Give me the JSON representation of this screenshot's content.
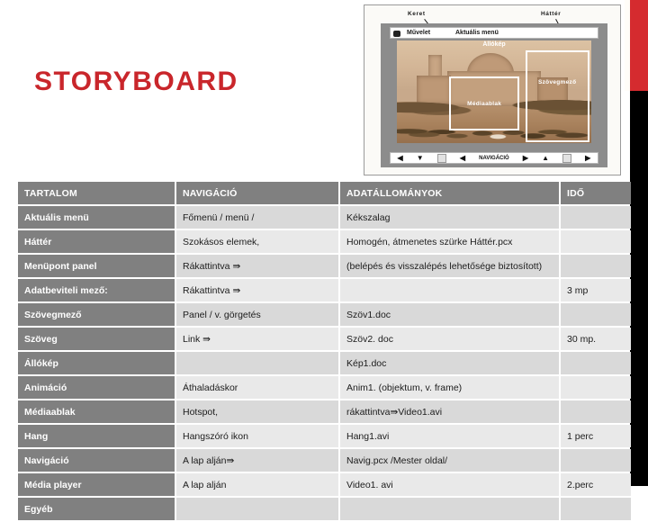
{
  "page_title": "STORYBOARD",
  "accent": {
    "red": "#d52b2f",
    "black": "#000000",
    "gray": "#808080"
  },
  "mockup": {
    "annotations": {
      "frame_label": "Keret",
      "background_label": "Háttér"
    },
    "menubar": {
      "action_label": "Művelet",
      "current_menu_label": "Aktuális menü",
      "icon": "speaker-icon"
    },
    "overlays": {
      "stillimage_label": "Állókép",
      "mediawindow_label": "Médiaablak",
      "textfield_label": "Szövegmező"
    },
    "navbar": {
      "label": "NAVIGÁCIÓ",
      "buttons": [
        "nav-left-icon",
        "nav-down-icon",
        "nav-box-icon",
        "nav-back-icon",
        "nav-forward-icon",
        "nav-up-icon",
        "nav-box2-icon",
        "nav-end-icon"
      ],
      "glyphs": [
        "◀",
        "▼",
        "▣",
        "◀",
        "▶",
        "▲",
        "▣",
        "▶|"
      ]
    }
  },
  "table": {
    "headers": [
      "TARTALOM",
      "NAVIGÁCIÓ",
      "ADATÁLLOMÁNYOK",
      "IDŐ"
    ],
    "rows": [
      {
        "tartalom": "Aktuális menü",
        "navigacio": "Főmenü / menü /",
        "adatallomanyok": "Kékszalag",
        "ido": ""
      },
      {
        "tartalom": "Háttér",
        "navigacio": "Szokásos elemek,",
        "adatallomanyok": "Homogén, átmenetes szürke Háttér.pcx",
        "ido": ""
      },
      {
        "tartalom": "Menüpont panel",
        "navigacio": "Rákattintva ⇛",
        "adatallomanyok": "(belépés és visszalépés lehetősége biztosított)",
        "ido": ""
      },
      {
        "tartalom": "Adatbeviteli mező:",
        "navigacio": "Rákattintva ⇛",
        "adatallomanyok": "",
        "ido": "3 mp"
      },
      {
        "tartalom": "Szövegmező",
        "navigacio": "Panel / v. görgetés",
        "adatallomanyok": "Szöv1.doc",
        "ido": ""
      },
      {
        "tartalom": "Szöveg",
        "navigacio": "Link ⇛",
        "adatallomanyok": "Szöv2. doc",
        "ido": "30 mp."
      },
      {
        "tartalom": "Állókép",
        "navigacio": "",
        "adatallomanyok": "Kép1.doc",
        "ido": ""
      },
      {
        "tartalom": "Animáció",
        "navigacio": "Áthaladáskor",
        "adatallomanyok": "Anim1. (objektum, v. frame)",
        "ido": ""
      },
      {
        "tartalom": "Médiaablak",
        "navigacio": "Hotspot,",
        "adatallomanyok": "rákattintva⇛Video1.avi",
        "ido": ""
      },
      {
        "tartalom": "Hang",
        "navigacio": "Hangszóró ikon",
        "adatallomanyok": "Hang1.avi",
        "ido": "1 perc"
      },
      {
        "tartalom": "Navigáció",
        "navigacio": "A lap alján⇛",
        "adatallomanyok": "Navig.pcx /Mester oldal/",
        "ido": ""
      },
      {
        "tartalom": "Média player",
        "navigacio": "A lap alján",
        "adatallomanyok": "Video1. avi",
        "ido": "2.perc"
      },
      {
        "tartalom": "Egyéb",
        "navigacio": "",
        "adatallomanyok": "",
        "ido": ""
      }
    ]
  }
}
